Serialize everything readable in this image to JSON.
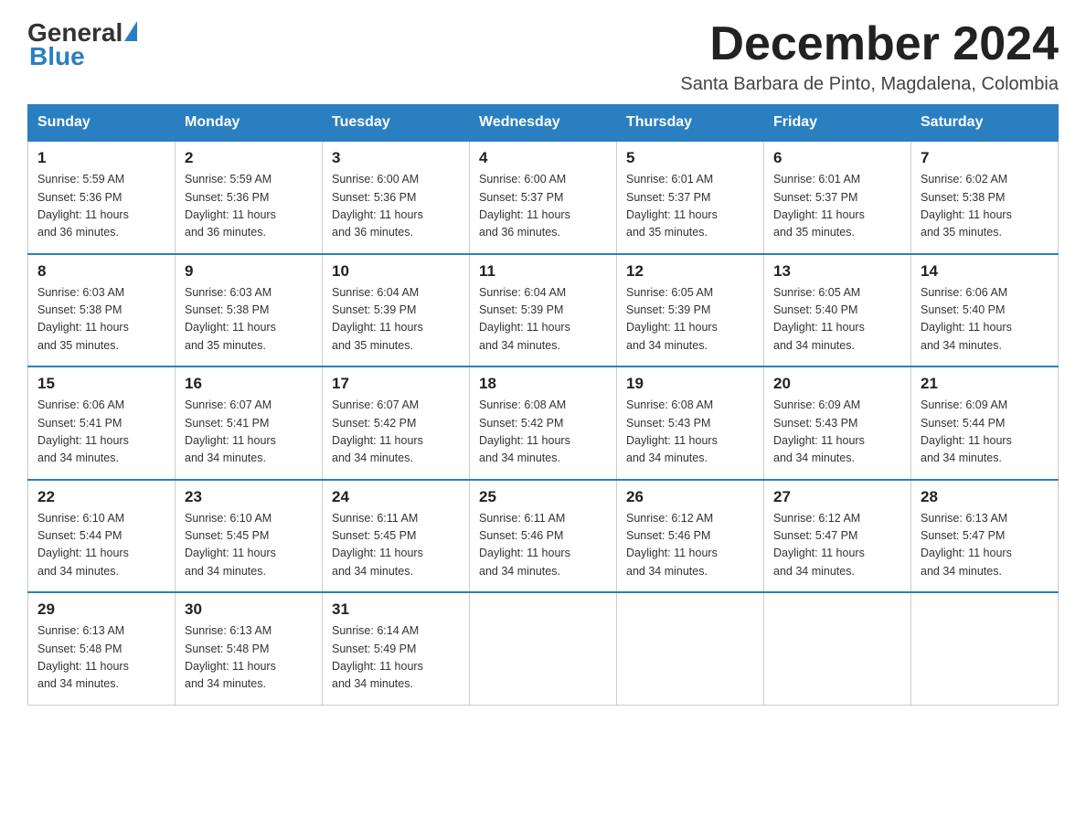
{
  "header": {
    "logo_general": "General",
    "logo_blue": "Blue",
    "title": "December 2024",
    "location": "Santa Barbara de Pinto, Magdalena, Colombia"
  },
  "weekdays": [
    "Sunday",
    "Monday",
    "Tuesday",
    "Wednesday",
    "Thursday",
    "Friday",
    "Saturday"
  ],
  "weeks": [
    [
      {
        "day": "1",
        "sunrise": "5:59 AM",
        "sunset": "5:36 PM",
        "daylight": "11 hours and 36 minutes."
      },
      {
        "day": "2",
        "sunrise": "5:59 AM",
        "sunset": "5:36 PM",
        "daylight": "11 hours and 36 minutes."
      },
      {
        "day": "3",
        "sunrise": "6:00 AM",
        "sunset": "5:36 PM",
        "daylight": "11 hours and 36 minutes."
      },
      {
        "day": "4",
        "sunrise": "6:00 AM",
        "sunset": "5:37 PM",
        "daylight": "11 hours and 36 minutes."
      },
      {
        "day": "5",
        "sunrise": "6:01 AM",
        "sunset": "5:37 PM",
        "daylight": "11 hours and 35 minutes."
      },
      {
        "day": "6",
        "sunrise": "6:01 AM",
        "sunset": "5:37 PM",
        "daylight": "11 hours and 35 minutes."
      },
      {
        "day": "7",
        "sunrise": "6:02 AM",
        "sunset": "5:38 PM",
        "daylight": "11 hours and 35 minutes."
      }
    ],
    [
      {
        "day": "8",
        "sunrise": "6:03 AM",
        "sunset": "5:38 PM",
        "daylight": "11 hours and 35 minutes."
      },
      {
        "day": "9",
        "sunrise": "6:03 AM",
        "sunset": "5:38 PM",
        "daylight": "11 hours and 35 minutes."
      },
      {
        "day": "10",
        "sunrise": "6:04 AM",
        "sunset": "5:39 PM",
        "daylight": "11 hours and 35 minutes."
      },
      {
        "day": "11",
        "sunrise": "6:04 AM",
        "sunset": "5:39 PM",
        "daylight": "11 hours and 34 minutes."
      },
      {
        "day": "12",
        "sunrise": "6:05 AM",
        "sunset": "5:39 PM",
        "daylight": "11 hours and 34 minutes."
      },
      {
        "day": "13",
        "sunrise": "6:05 AM",
        "sunset": "5:40 PM",
        "daylight": "11 hours and 34 minutes."
      },
      {
        "day": "14",
        "sunrise": "6:06 AM",
        "sunset": "5:40 PM",
        "daylight": "11 hours and 34 minutes."
      }
    ],
    [
      {
        "day": "15",
        "sunrise": "6:06 AM",
        "sunset": "5:41 PM",
        "daylight": "11 hours and 34 minutes."
      },
      {
        "day": "16",
        "sunrise": "6:07 AM",
        "sunset": "5:41 PM",
        "daylight": "11 hours and 34 minutes."
      },
      {
        "day": "17",
        "sunrise": "6:07 AM",
        "sunset": "5:42 PM",
        "daylight": "11 hours and 34 minutes."
      },
      {
        "day": "18",
        "sunrise": "6:08 AM",
        "sunset": "5:42 PM",
        "daylight": "11 hours and 34 minutes."
      },
      {
        "day": "19",
        "sunrise": "6:08 AM",
        "sunset": "5:43 PM",
        "daylight": "11 hours and 34 minutes."
      },
      {
        "day": "20",
        "sunrise": "6:09 AM",
        "sunset": "5:43 PM",
        "daylight": "11 hours and 34 minutes."
      },
      {
        "day": "21",
        "sunrise": "6:09 AM",
        "sunset": "5:44 PM",
        "daylight": "11 hours and 34 minutes."
      }
    ],
    [
      {
        "day": "22",
        "sunrise": "6:10 AM",
        "sunset": "5:44 PM",
        "daylight": "11 hours and 34 minutes."
      },
      {
        "day": "23",
        "sunrise": "6:10 AM",
        "sunset": "5:45 PM",
        "daylight": "11 hours and 34 minutes."
      },
      {
        "day": "24",
        "sunrise": "6:11 AM",
        "sunset": "5:45 PM",
        "daylight": "11 hours and 34 minutes."
      },
      {
        "day": "25",
        "sunrise": "6:11 AM",
        "sunset": "5:46 PM",
        "daylight": "11 hours and 34 minutes."
      },
      {
        "day": "26",
        "sunrise": "6:12 AM",
        "sunset": "5:46 PM",
        "daylight": "11 hours and 34 minutes."
      },
      {
        "day": "27",
        "sunrise": "6:12 AM",
        "sunset": "5:47 PM",
        "daylight": "11 hours and 34 minutes."
      },
      {
        "day": "28",
        "sunrise": "6:13 AM",
        "sunset": "5:47 PM",
        "daylight": "11 hours and 34 minutes."
      }
    ],
    [
      {
        "day": "29",
        "sunrise": "6:13 AM",
        "sunset": "5:48 PM",
        "daylight": "11 hours and 34 minutes."
      },
      {
        "day": "30",
        "sunrise": "6:13 AM",
        "sunset": "5:48 PM",
        "daylight": "11 hours and 34 minutes."
      },
      {
        "day": "31",
        "sunrise": "6:14 AM",
        "sunset": "5:49 PM",
        "daylight": "11 hours and 34 minutes."
      },
      null,
      null,
      null,
      null
    ]
  ],
  "labels": {
    "sunrise": "Sunrise:",
    "sunset": "Sunset:",
    "daylight": "Daylight:"
  }
}
